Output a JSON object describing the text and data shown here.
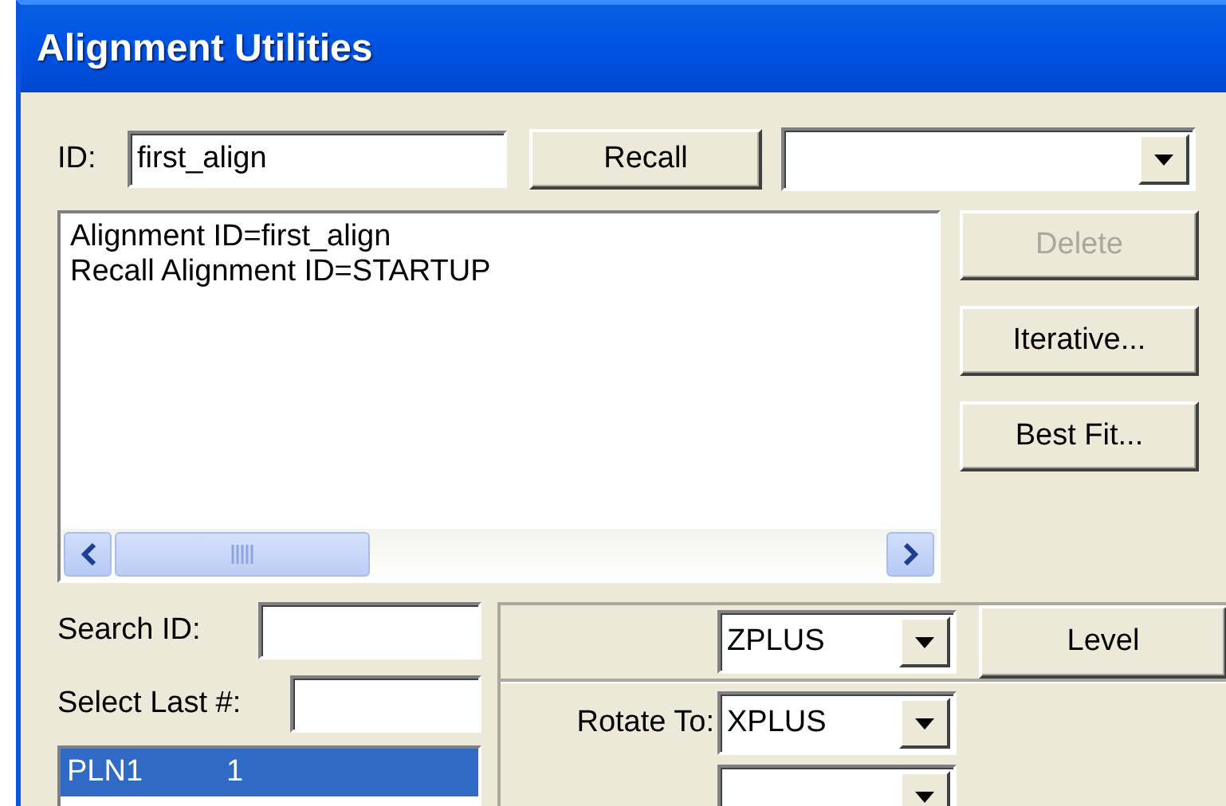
{
  "window": {
    "title": "Alignment Utilities"
  },
  "id_field": {
    "label": "ID:",
    "value": "first_align"
  },
  "recall_button": "Recall",
  "log_lines": [
    "Alignment ID=first_align",
    "Recall Alignment ID=STARTUP"
  ],
  "side_buttons": [
    {
      "label": "Delete",
      "disabled": true
    },
    {
      "label": "Iterative...",
      "disabled": false
    },
    {
      "label": "Best Fit...",
      "disabled": false
    }
  ],
  "search_id": {
    "label": "Search ID:"
  },
  "select_last": {
    "label": "Select Last #:"
  },
  "features": [
    {
      "name": "PLN1",
      "count": "1",
      "selected": true
    }
  ],
  "level": {
    "axis": "ZPLUS",
    "button": "Level"
  },
  "rotate": {
    "label": "Rotate To:",
    "axis": "XPLUS"
  }
}
